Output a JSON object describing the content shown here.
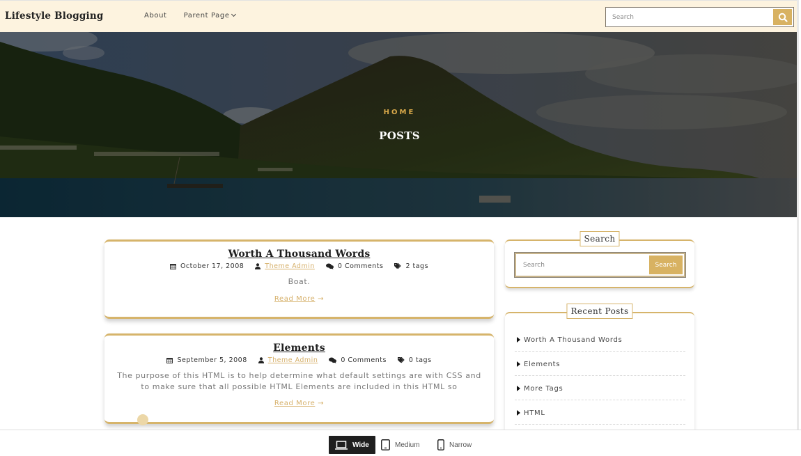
{
  "header": {
    "brand": "Lifestyle Blogging",
    "nav": [
      {
        "label": "About"
      },
      {
        "label": "Parent Page",
        "has_dropdown": true
      }
    ],
    "search": {
      "placeholder": "Search",
      "value": "",
      "icon": "search-icon"
    }
  },
  "hero": {
    "breadcrumb": "HOME",
    "title": "POSTS"
  },
  "posts": [
    {
      "title": "Worth A Thousand Words",
      "date": "October 17, 2008",
      "author": "Theme Admin",
      "comments": "0 Comments",
      "tags": "2 tags",
      "excerpt": "Boat.",
      "read_more": "Read More"
    },
    {
      "title": "Elements",
      "date": "September 5, 2008",
      "author": "Theme Admin",
      "comments": "0 Comments",
      "tags": "0 tags",
      "excerpt": "The purpose of this HTML is to help determine what default settings are with CSS and to make sure that all possible HTML Elements are included in this HTML so",
      "read_more": "Read More"
    }
  ],
  "sidebar": {
    "search_widget": {
      "title": "Search",
      "placeholder": "Search",
      "value": "",
      "button": "Search"
    },
    "recent_posts": {
      "title": "Recent Posts",
      "items": [
        {
          "label": "Worth A Thousand Words"
        },
        {
          "label": "Elements"
        },
        {
          "label": "More Tags"
        },
        {
          "label": "HTML"
        }
      ]
    }
  },
  "viewport_bar": {
    "options": [
      {
        "label": "Wide",
        "icon": "laptop-icon",
        "active": true
      },
      {
        "label": "Medium",
        "icon": "tablet-icon",
        "active": false
      },
      {
        "label": "Narrow",
        "icon": "phone-icon",
        "active": false
      }
    ]
  },
  "colors": {
    "accent": "#d8b262",
    "header_bg": "#fdf3df",
    "link": "#d6b06a"
  }
}
